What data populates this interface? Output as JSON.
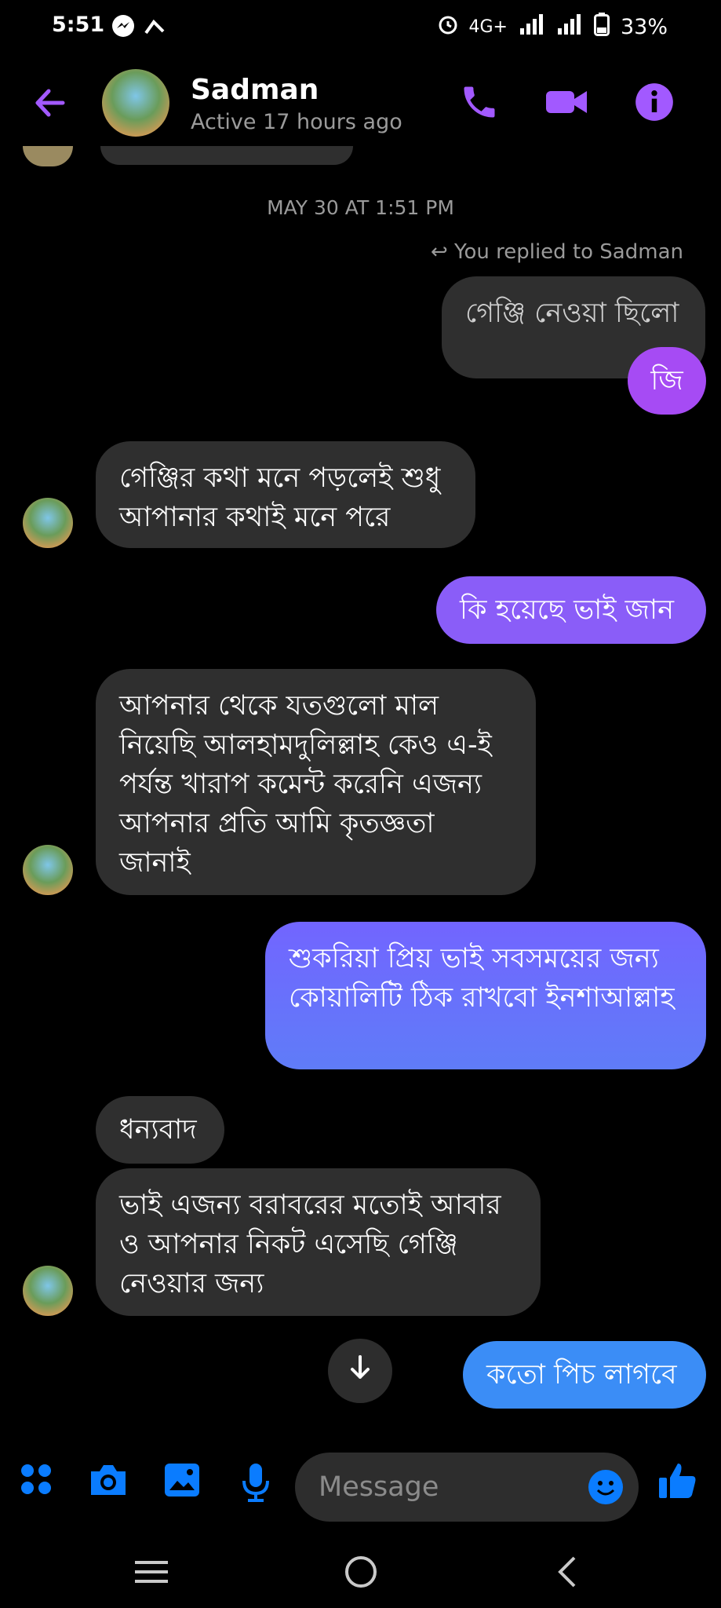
{
  "status_bar": {
    "time": "5:51",
    "network": "4G+",
    "battery": "33%"
  },
  "header": {
    "name": "Sadman",
    "status": "Active 17 hours ago"
  },
  "timestamp": "MAY 30 AT 1:51 PM",
  "replied_note": "You replied to Sadman",
  "messages": [
    {
      "text": "গেঞ্জি নেওয়া ছিলো"
    },
    {
      "text": "জি"
    },
    {
      "text": "গেঞ্জির কথা মনে পড়লেই শুধু আপানার কথাই মনে পরে"
    },
    {
      "text": "কি হয়েছে ভাই জান"
    },
    {
      "text": "আপনার থেকে যতগুলো মাল নিয়েছি আলহামদুলিল্লাহ কেও এ-ই পর্যন্ত খারাপ কমেন্ট করেনি এজন্য আপনার প্রতি আমি কৃতজ্ঞতা জানাই"
    },
    {
      "text": "শুকরিয়া প্রিয় ভাই সবসময়ের জন্য কোয়ালিটি ঠিক রাখবো ইনশাআল্লাহ"
    },
    {
      "text": "ধন্যবাদ"
    },
    {
      "text": "ভাই এজন্য বরাবরের মতোই আবার ও আপনার নিকট এসেছি গেঞ্জি নেওয়ার জন্য"
    },
    {
      "text": "কতো পিচ লাগবে"
    }
  ],
  "composer": {
    "placeholder": "Message"
  },
  "colors": {
    "accent": "#a259ff",
    "blue": "#0a7cff"
  }
}
